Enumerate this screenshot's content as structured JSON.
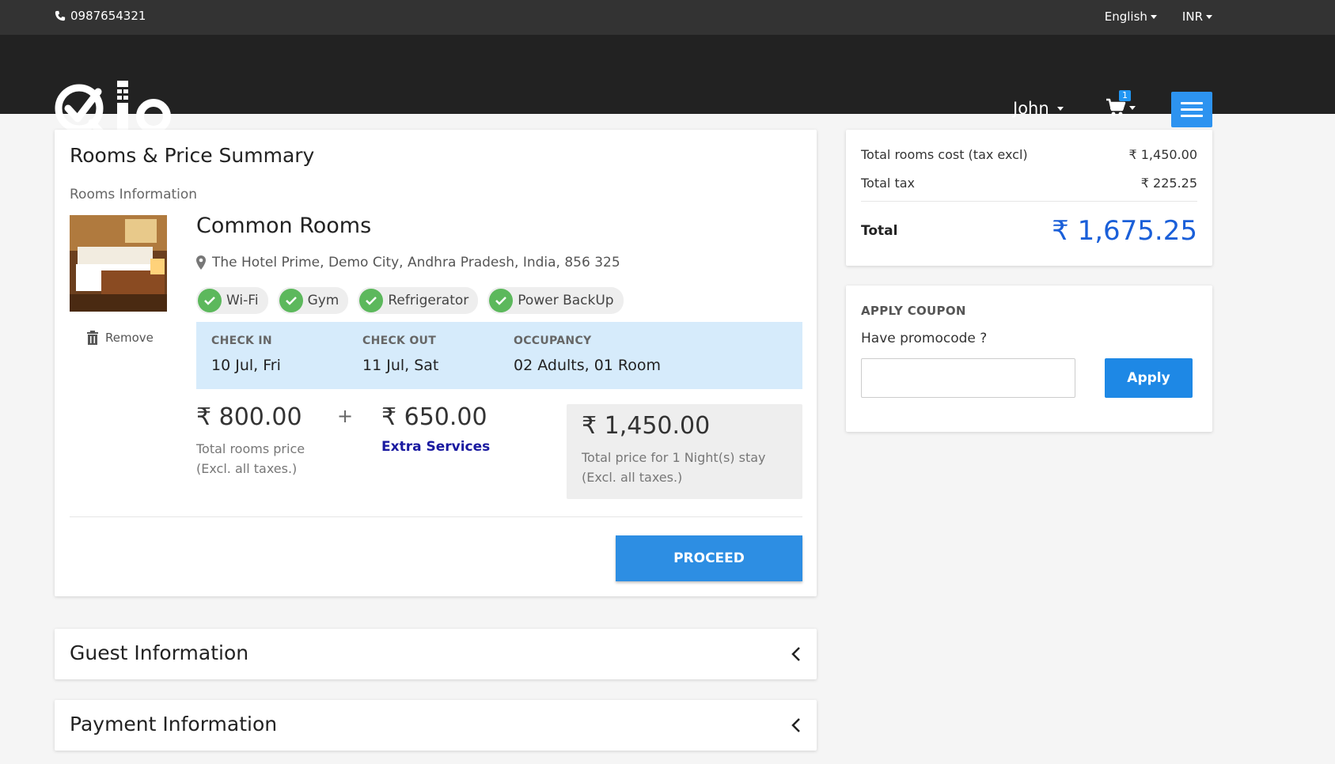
{
  "topbar": {
    "phone": "0987654321",
    "language": "English",
    "currency": "INR"
  },
  "header": {
    "user": "John",
    "cart_count": "1"
  },
  "summary": {
    "title": "Rooms & Price Summary",
    "rooms_info_label": "Rooms Information",
    "remove_label": "Remove",
    "room_name": "Common Rooms",
    "address": "The Hotel Prime, Demo City, Andhra Pradesh, India, 856 325",
    "amenities": [
      "Wi-Fi",
      "Gym",
      "Refrigerator",
      "Power BackUp"
    ],
    "check_in_label": "CHECK IN",
    "check_in": "10 Jul, Fri",
    "check_out_label": "CHECK OUT",
    "check_out": "11 Jul, Sat",
    "occupancy_label": "OCCUPANCY",
    "occupancy": "02 Adults, 01 Room",
    "rooms_price": "₹ 800.00",
    "rooms_price_label_1": "Total rooms price",
    "rooms_price_label_2": "(Excl. all taxes.)",
    "plus": "+",
    "extra_price": "₹ 650.00",
    "extra_label": "Extra Services",
    "total_price": "₹ 1,450.00",
    "total_label_1": "Total price for 1 Night(s) stay",
    "total_label_2": "(Excl. all taxes.)",
    "proceed_label": "PROCEED"
  },
  "guest_info": {
    "title": "Guest Information"
  },
  "payment_info": {
    "title": "Payment Information"
  },
  "totals": {
    "rooms_cost_label": "Total rooms cost (tax excl)",
    "rooms_cost": "₹ 1,450.00",
    "tax_label": "Total tax",
    "tax": "₹ 225.25",
    "total_label": "Total",
    "total": "₹ 1,675.25"
  },
  "coupon": {
    "heading": "APPLY COUPON",
    "question": "Have promocode ?",
    "input_value": "",
    "apply_label": "Apply"
  },
  "colors": {
    "accent": "#2d8ee3",
    "total_blue": "#1a5fd9",
    "dates_bg": "#d6ebfb",
    "check_green": "#5cb85c"
  }
}
